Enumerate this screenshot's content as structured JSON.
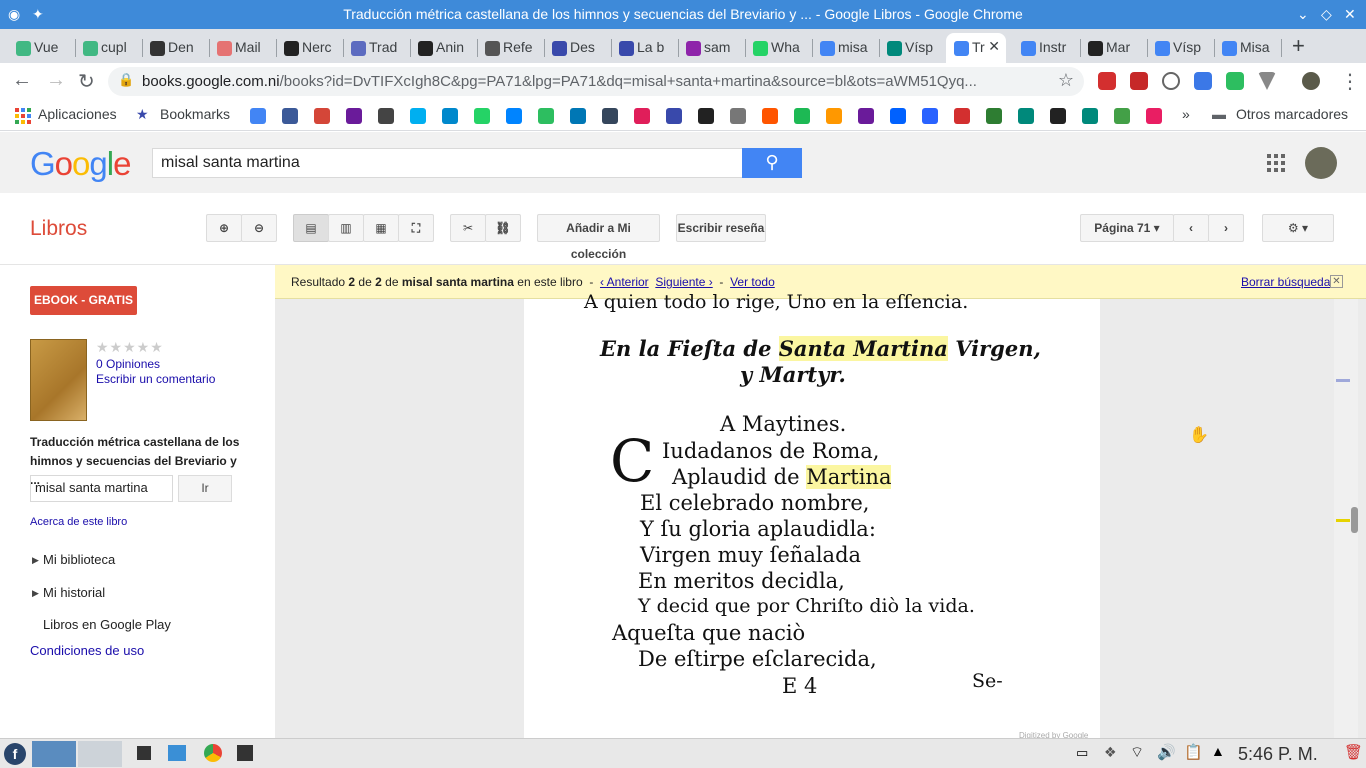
{
  "window": {
    "title": "Traducción métrica castellana de los himnos y secuencias del Breviario y ... - Google Libros - Google Chrome"
  },
  "tabs": [
    {
      "label": "Vue",
      "icon": "vue-icon",
      "color": "#41b883"
    },
    {
      "label": "cupl",
      "icon": "vue-icon",
      "color": "#41b883"
    },
    {
      "label": "Den",
      "icon": "mail-icon",
      "color": "#333"
    },
    {
      "label": "Mail",
      "icon": "mail-icon",
      "color": "#e57373"
    },
    {
      "label": "Nerc",
      "icon": "github-icon",
      "color": "#222"
    },
    {
      "label": "Trad",
      "icon": "translate-icon",
      "color": "#5c6bc0"
    },
    {
      "label": "Anin",
      "icon": "af-icon",
      "color": "#222"
    },
    {
      "label": "Refe",
      "icon": "globe-icon",
      "color": "#555"
    },
    {
      "label": "Des",
      "icon": "book-icon",
      "color": "#3949ab"
    },
    {
      "label": "La b",
      "icon": "book-icon",
      "color": "#3949ab"
    },
    {
      "label": "sam",
      "icon": "mail-icon",
      "color": "#8e24aa"
    },
    {
      "label": "Wha",
      "icon": "whatsapp-icon",
      "color": "#25d366"
    },
    {
      "label": "misa",
      "icon": "google-icon",
      "color": "#4285f4"
    },
    {
      "label": "Vísp",
      "icon": "s-icon",
      "color": "#00897b"
    },
    {
      "label": "Tr",
      "icon": "google-icon",
      "color": "#4285f4",
      "active": true
    },
    {
      "label": "Instr",
      "icon": "google-icon",
      "color": "#4285f4"
    },
    {
      "label": "Mar",
      "icon": "wikipedia-icon",
      "color": "#222"
    },
    {
      "label": "Vísp",
      "icon": "google-icon",
      "color": "#4285f4"
    },
    {
      "label": "Misa",
      "icon": "google-icon",
      "color": "#4285f4"
    }
  ],
  "address": {
    "domain": "books.google.com.ni",
    "path": "/books?id=DvTIFXcIgh8C&pg=PA71&lpg=PA71&dq=misal+santa+martina&source=bl&ots=aWM51Qyq..."
  },
  "bookmarks": {
    "apps": "Aplicaciones",
    "bookmarks": "Bookmarks",
    "more": "»",
    "others": "Otros marcadores"
  },
  "google": {
    "logo": "Google",
    "query": "misal santa martina"
  },
  "toolbar": {
    "section": "Libros",
    "add_collection": "Añadir a Mi colección",
    "write_review": "Escribir reseña",
    "page_select": "Página 71"
  },
  "sidebar": {
    "ebook": "EBOOK - GRATIS",
    "rating_stars": "★★★★★",
    "opinions": "0 Opiniones",
    "write_comment": "Escribir un comentario",
    "book_title": "Traducción métrica castellana de los himnos y secuencias del Breviario y ...",
    "search_value": "misal santa martina",
    "go": "Ir",
    "about": "Acerca de este libro",
    "my_library": "Mi biblioteca",
    "my_history": "Mi historial",
    "play": "Libros en Google Play",
    "terms": "Condiciones de uso"
  },
  "result": {
    "prefix": "Resultado",
    "current": "2",
    "of": "de",
    "total": "2",
    "query": "misal santa martina",
    "suffix": "en este libro",
    "sep": "-",
    "prev": "‹ Anterior",
    "next": "Siguiente ›",
    "all": "Ver todo",
    "clear": "Borrar búsqueda",
    "close": "✕"
  },
  "page_text": {
    "top_line": "A quien todo lo rige, Uno en la eſſencia.",
    "heading1a": "En la Fieſta de ",
    "heading1_hl": "Santa Martina",
    "heading1b": " Virgen,",
    "heading2": "y Martyr.",
    "subheading": "A Maytines.",
    "dropcap": "C",
    "l1": "Iudadanos de Roma,",
    "l2a": "Aplaudid de ",
    "l2_hl": "Martina",
    "l3": "El celebrado nombre,",
    "l4": "Y ſu gloria aplaudidla:",
    "l5": "Virgen muy ſeñalada",
    "l6": "En meritos decidla,",
    "l7": "Y decid que por Chriſto diò la vida.",
    "l8": "Aqueſta que naciò",
    "l9": "De eſtirpe eſclarecida,",
    "signature": "E 4",
    "catchword": "Se-",
    "digitized": "Digitized by Google"
  },
  "taskbar": {
    "clock": "5:46 P. M."
  }
}
